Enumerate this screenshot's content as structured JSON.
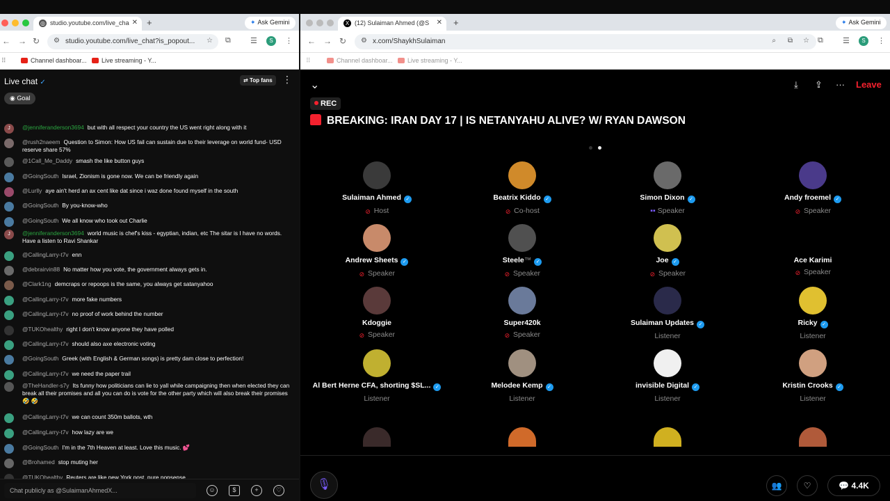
{
  "left_window": {
    "tab_title": "studio.youtube.com/live_cha",
    "ask_gemini": "Ask Gemini",
    "url": "studio.youtube.com/live_chat?is_popout...",
    "profile_initial": "S",
    "bookmarks": [
      "Channel dashboar...",
      "Live streaming - Y..."
    ],
    "chat_title": "Live chat",
    "top_fans": "Top fans",
    "goal": "Goal",
    "input_placeholder": "Chat publicly as @SulaimanAhmedX..."
  },
  "right_window": {
    "tab_title": "(12) Sulaiman Ahmed (@S",
    "ask_gemini": "Ask Gemini",
    "url": "x.com/ShaykhSulaiman",
    "profile_initial": "S",
    "bookmarks": [
      "Channel dashboar...",
      "Live streaming - Y..."
    ]
  },
  "chat_messages": [
    {
      "author": "@jenniferanderson3694",
      "text": "but with all respect your country the US went right along with it",
      "avatar": "J",
      "color": "#8a4a4a",
      "green": true
    },
    {
      "author": "@rush2naeem",
      "text": "Question to Simon: How US fail can sustain due to their leverage on world fund- USD reserve share 57%",
      "avatar": "",
      "color": "#7a6a6a",
      "green": false
    },
    {
      "author": "@1Call_Me_Daddy",
      "text": "smash the like button guys",
      "avatar": "",
      "color": "#5a5a5a",
      "green": false
    },
    {
      "author": "@GoingSouth",
      "text": "Israel, Zionism is gone now. We can be friendly again",
      "avatar": "",
      "color": "#4a7aa0",
      "green": false
    },
    {
      "author": "@Lurlly",
      "text": "aye ain't herd an ax cent like dat since i waz done found myself in the south",
      "avatar": "",
      "color": "#9a4a6a",
      "green": false
    },
    {
      "author": "@GoingSouth",
      "text": "By you-know-who",
      "avatar": "",
      "color": "#4a7aa0",
      "green": false
    },
    {
      "author": "@GoingSouth",
      "text": "We all know who took out Charlie",
      "avatar": "",
      "color": "#4a7aa0",
      "green": false
    },
    {
      "author": "@jenniferanderson3694",
      "text": "world music is chef's kiss - egyptian, indian, etc The sitar is I have no words. Have a listen to Ravi Shankar",
      "avatar": "J",
      "color": "#8a4a4a",
      "green": true
    },
    {
      "author": "@CallingLarry-t7v",
      "text": "enn",
      "avatar": "",
      "color": "#3aa080",
      "green": false
    },
    {
      "author": "@debrairvin88",
      "text": "No matter how you vote, the government always gets in.",
      "avatar": "",
      "color": "#6a6a6a",
      "green": false
    },
    {
      "author": "@Clark1ng",
      "text": "demcraps or repoops is the same, you always get satanyahoo",
      "avatar": "",
      "color": "#7a5a4a",
      "green": false
    },
    {
      "author": "@CallingLarry-t7v",
      "text": "more fake numbers",
      "avatar": "",
      "color": "#3aa080",
      "green": false
    },
    {
      "author": "@CallingLarry-t7v",
      "text": "no proof of work behind the number",
      "avatar": "",
      "color": "#3aa080",
      "green": false
    },
    {
      "author": "@TUKOhealthy",
      "text": "right I don't know anyone they have polled",
      "avatar": "",
      "color": "#333",
      "green": false
    },
    {
      "author": "@CallingLarry-t7v",
      "text": "should also axe electronic voting",
      "avatar": "",
      "color": "#3aa080",
      "green": false
    },
    {
      "author": "@GoingSouth",
      "text": "Greek (with English & German songs) is pretty dam close to perfection!",
      "avatar": "",
      "color": "#4a7aa0",
      "green": false
    },
    {
      "author": "@CallingLarry-t7v",
      "text": "we need the paper trail",
      "avatar": "",
      "color": "#3aa080",
      "green": false
    },
    {
      "author": "@TheHandler-s7y",
      "text": "Its funny how politicians can lie to yall while campaigning then when elected they can break all their promises and all you can do is vote for the other party which will also break their promises 🤣 🤣",
      "avatar": "",
      "color": "#555",
      "green": false
    },
    {
      "author": "@CallingLarry-t7v",
      "text": "we can count 350m ballots, wth",
      "avatar": "",
      "color": "#3aa080",
      "green": false
    },
    {
      "author": "@CallingLarry-t7v",
      "text": "how lazy are we",
      "avatar": "",
      "color": "#3aa080",
      "green": false
    },
    {
      "author": "@GoingSouth",
      "text": "I'm in the 7th Heaven at least. Love this music. 💕",
      "avatar": "",
      "color": "#4a7aa0",
      "green": false
    },
    {
      "author": "@Brohamed",
      "text": "stop muting her",
      "avatar": "",
      "color": "#666",
      "green": false
    },
    {
      "author": "@TUKOhealthy",
      "text": "Reuters are like new York post. pure nonsense",
      "avatar": "",
      "color": "#333",
      "green": false
    }
  ],
  "space": {
    "leave": "Leave",
    "rec": "REC",
    "title": "BREAKING: IRAN DAY 17 | IS NETANYAHU ALIVE? W/ RYAN DAWSON",
    "count": "4.4K",
    "participants": [
      {
        "name": "Sulaiman Ahmed",
        "role": "Host",
        "verified": true,
        "muted": true,
        "color": "#3a3a3a"
      },
      {
        "name": "Beatrix Kiddo",
        "role": "Co-host",
        "verified": true,
        "muted": true,
        "color": "#d08a2a"
      },
      {
        "name": "Simon Dixon",
        "role": "Speaker",
        "verified": true,
        "muted": false,
        "speaking": true,
        "color": "#6a6a6a"
      },
      {
        "name": "Andy froemel",
        "role": "Speaker",
        "verified": true,
        "muted": true,
        "color": "#4a3a8a"
      },
      {
        "name": "Andrew Sheets",
        "role": "Speaker",
        "verified": true,
        "muted": true,
        "color": "#c88a6a"
      },
      {
        "name": "Steele",
        "role": "Speaker",
        "verified": true,
        "muted": true,
        "color": "#505050",
        "suffix": "™"
      },
      {
        "name": "Joe",
        "role": "Speaker",
        "verified": true,
        "muted": true,
        "color": "#d0c050"
      },
      {
        "name": "Ace Karimi",
        "role": "Speaker",
        "verified": false,
        "muted": true,
        "color": "#000000"
      },
      {
        "name": "Kdoggie",
        "role": "Speaker",
        "verified": false,
        "muted": true,
        "color": "#5a3a3a"
      },
      {
        "name": "Super420k",
        "role": "Speaker",
        "verified": false,
        "muted": true,
        "color": "#6a7a9a"
      },
      {
        "name": "Sulaiman Updates",
        "role": "Listener",
        "verified": true,
        "muted": false,
        "color": "#2a2a4a"
      },
      {
        "name": "Ricky",
        "role": "Listener",
        "verified": true,
        "muted": false,
        "color": "#e0c030"
      },
      {
        "name": "Al Bert Herne CFA, shorting $SL...",
        "role": "Listener",
        "verified": true,
        "muted": false,
        "color": "#c0b030"
      },
      {
        "name": "Melodee Kemp",
        "role": "Listener",
        "verified": true,
        "muted": false,
        "color": "#a09080"
      },
      {
        "name": "invisible Digital",
        "role": "Listener",
        "verified": true,
        "muted": false,
        "color": "#f0f0f0"
      },
      {
        "name": "Kristin Crooks",
        "role": "Listener",
        "verified": true,
        "muted": false,
        "color": "#d0a080"
      }
    ]
  }
}
